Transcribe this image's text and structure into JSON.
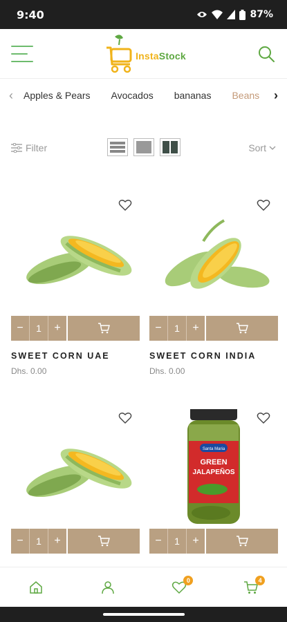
{
  "status_bar": {
    "time": "9:40",
    "battery": "87%"
  },
  "header": {
    "logo_part1": "Insta",
    "logo_part2": "Stock",
    "accent_green": "#5ea842",
    "accent_yellow": "#f0b31a"
  },
  "categories": {
    "items": [
      "Apples & Pears",
      "Avocados",
      "bananas",
      "Beans"
    ],
    "active_index": 3
  },
  "toolbar": {
    "filter_label": "Filter",
    "sort_label": "Sort"
  },
  "products": [
    {
      "name": "SWEET CORN UAE",
      "price": "Dhs. 0.00",
      "qty": "1",
      "image": "corn-two-cobs"
    },
    {
      "name": "SWEET CORN INDIA",
      "price": "Dhs. 0.00",
      "qty": "1",
      "image": "corn-three-cobs"
    },
    {
      "name": "",
      "price": "",
      "qty": "1",
      "image": "corn-two-cobs"
    },
    {
      "name": "",
      "price": "",
      "qty": "1",
      "image": "green-jalapenos-jar"
    }
  ],
  "jar_label": {
    "brand": "Santa Maria",
    "line1": "GREEN",
    "line2": "JALAPEÑOS"
  },
  "cart_controls": {
    "minus": "−",
    "plus": "+"
  },
  "bottom_nav": {
    "wishlist_count": "0",
    "cart_count": "4"
  },
  "colors": {
    "cart_bar": "#b9a082",
    "badge": "#f0a020",
    "active_category": "#c49a78"
  }
}
